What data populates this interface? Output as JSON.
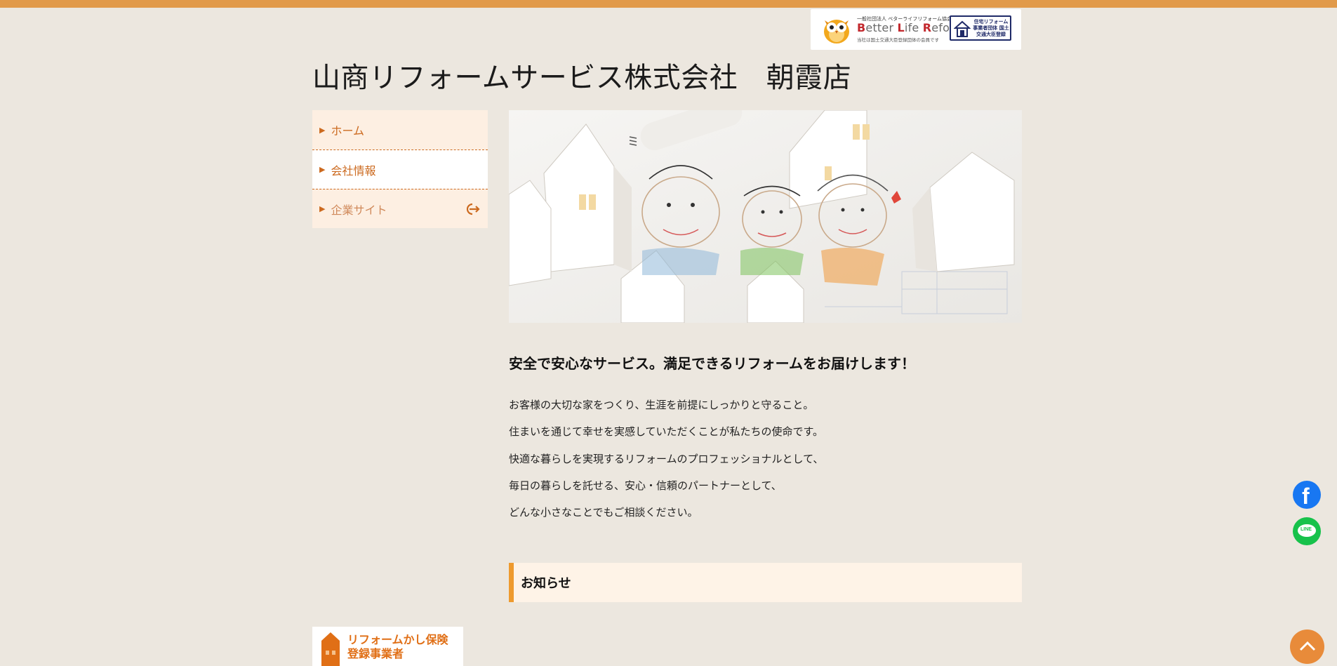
{
  "header": {
    "site_title": "山商リフォームサービス株式会社　朝霞店",
    "badge": {
      "org_line": "一般社団法人 ベターライフリフォーム協会",
      "logo_b": "B",
      "logo_etter": "etter ",
      "logo_l": "L",
      "logo_ife": "ife ",
      "logo_r": "R",
      "logo_eform": "eform",
      "note": "当社は国土交通大臣登録団体の会員です",
      "registration_text": "住宅リフォーム 事業者団体 国土交通大臣登録"
    }
  },
  "sidebar": {
    "items": [
      {
        "label": "ホーム"
      },
      {
        "label": "会社情報"
      },
      {
        "label": "企業サイト"
      }
    ]
  },
  "main": {
    "headline": "安全で安心なサービス。満足できるリフォームをお届けします！",
    "lines": [
      "お客様の大切な家をつくり、生涯を前提にしっかりと守ること。",
      "住まいを通じて幸せを実感していただくことが私たちの使命です。",
      "快適な暮らしを実現するリフォームのプロフェッショナルとして、",
      "毎日の暮らしを託せる、安心・信頼のパートナーとして、",
      "どんな小さなことでもご相談ください。"
    ],
    "news_heading": "お知らせ"
  },
  "insurance_badge": {
    "line1": "リフォームかし保険",
    "line2": "登録事業者"
  },
  "social": {
    "facebook_glyph": "f",
    "line_label": "LINE"
  },
  "colors": {
    "accent_bar": "#e19a4a",
    "nav_text": "#cc6a1f",
    "news_border": "#ee9a2e",
    "page_bg": "#ece7df"
  }
}
